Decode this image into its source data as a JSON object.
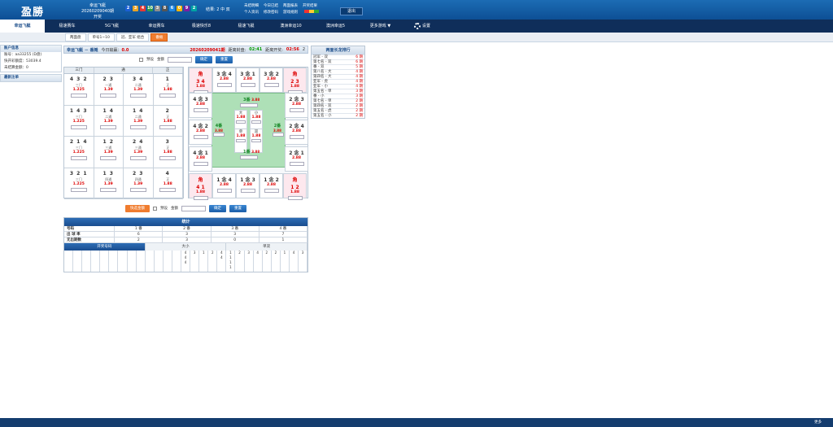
{
  "header": {
    "logo": "盈勝",
    "lottery_name": "幸运飞艇",
    "period_text": "20260209040期开奖",
    "balls": [
      {
        "num": "2",
        "color": "#1b5fd3"
      },
      {
        "num": "3",
        "color": "#e8a325"
      },
      {
        "num": "4",
        "color": "#e53935"
      },
      {
        "num": "10",
        "color": "#2e9a46"
      },
      {
        "num": "3",
        "color": "#8d8d8d"
      },
      {
        "num": "8",
        "color": "#555555"
      },
      {
        "num": "6",
        "color": "#1e88e5"
      },
      {
        "num": "0",
        "color": "#f6b400"
      },
      {
        "num": "9",
        "color": "#7b1fa2"
      },
      {
        "num": "2",
        "color": "#00a3a3"
      }
    ],
    "result_label": "结果:",
    "result_a": "2",
    "result_b": "中 双",
    "links": [
      "未结明细",
      "今日已结",
      "两面报表",
      "开奖结果",
      "个人资讯",
      "修改密码",
      "游戏规则",
      ""
    ],
    "logout": "退出"
  },
  "nav": {
    "tabs": [
      "幸运飞艇",
      "极速赛车",
      "5G飞艇",
      "幸运赛车",
      "极速快乐8",
      "极速飞艇",
      "澳洲幸运10",
      "澳洲幸运5",
      "更多游戏 ▼"
    ],
    "settings": "设置"
  },
  "subnav": [
    "两面盘",
    "单号1~10",
    "冠、亚军 组合",
    "番摊"
  ],
  "side": {
    "account_title": "账户信息",
    "account_label": "账号：",
    "account_value": "aa33255 (D盘)",
    "credit_label": "快开彩额度：",
    "credit_value": "53039.4",
    "unsettled_label": "未结算金额：",
    "unsettled_value": "0",
    "recent_title": "最新注单"
  },
  "main": {
    "game": "幸运飞艇 － 番摊",
    "pnl_label": "今日输赢：",
    "pnl_value": "0.0",
    "period": "20260209041期",
    "close_label": "距离封盘:",
    "close_time": "02:41",
    "draw_label": "距离开奖:",
    "draw_time": "02:56",
    "tail": "2",
    "preset": "预设",
    "amount": "金额",
    "confirm": "确定",
    "reset": "重置",
    "quick": "快选金额"
  },
  "table_heads": [
    "三门",
    "通",
    "正"
  ],
  "rows": [
    [
      {
        "n": "4 3 2",
        "l": "三门",
        "o": "1.225"
      },
      {
        "n": "2 3",
        "l": "一通",
        "o": "1.39"
      },
      {
        "n": "3 4",
        "l": "二通",
        "o": "1.39"
      },
      {
        "n": "1",
        "l": "正",
        "o": "1.88"
      }
    ],
    [
      {
        "n": "1 4 3",
        "l": "三门",
        "o": "1.225"
      },
      {
        "n": "1 4",
        "l": "二通",
        "o": "1.39"
      },
      {
        "n": "1 4",
        "l": "二通",
        "o": "1.39"
      },
      {
        "n": "2",
        "l": "正",
        "o": "1.88"
      }
    ],
    [
      {
        "n": "2 1 4",
        "l": "三门",
        "o": "1.225"
      },
      {
        "n": "1 2",
        "l": "三通",
        "o": "1.39"
      },
      {
        "n": "2 4",
        "l": "三通",
        "o": "1.39"
      },
      {
        "n": "3",
        "l": "正",
        "o": "1.88"
      }
    ],
    [
      {
        "n": "3 2 1",
        "l": "三门",
        "o": "1.225"
      },
      {
        "n": "1 3",
        "l": "四通",
        "o": "1.39"
      },
      {
        "n": "2 3",
        "l": "四通",
        "o": "1.39"
      },
      {
        "n": "4",
        "l": "正",
        "o": "1.88"
      }
    ]
  ],
  "board": {
    "top": [
      {
        "n": "角",
        "s": "3 4",
        "o": "1.88",
        "p": true
      },
      {
        "n": "3 念 4",
        "o": "2.88"
      },
      {
        "n": "3 念 1",
        "o": "2.88"
      },
      {
        "n": "3 念 2",
        "o": "2.88"
      },
      {
        "n": "角",
        "s": "2 3",
        "o": "1.88",
        "p": true
      }
    ],
    "left": [
      {
        "n": "4 念 3",
        "o": "2.88"
      },
      {
        "n": "4 念 2",
        "o": "2.88"
      },
      {
        "n": "4 念 1",
        "o": "2.88"
      }
    ],
    "right": [
      {
        "n": "2 念 3",
        "o": "2.88"
      },
      {
        "n": "2 念 4",
        "o": "2.88"
      },
      {
        "n": "2 念 1",
        "o": "2.88"
      }
    ],
    "bottom": [
      {
        "n": "角",
        "s": "4 1",
        "o": "1.88",
        "p": true
      },
      {
        "n": "1 念 4",
        "o": "2.88"
      },
      {
        "n": "1 念 3",
        "o": "2.88"
      },
      {
        "n": "1 念 2",
        "o": "2.88"
      },
      {
        "n": "角",
        "s": "1 2",
        "o": "1.88",
        "p": true
      }
    ],
    "fan3": "3番",
    "fan3_o": "3.88",
    "fan4": "4番",
    "fan4_o": "3.88",
    "fan2": "2番",
    "fan2_o": "3.88",
    "fan1": "1番",
    "fan1_o": "3.88",
    "big": "大",
    "big_o": "1.88",
    "small": "小",
    "small_o": "1.88",
    "odd": "单",
    "odd_o": "1.88",
    "even": "双",
    "even_o": "1.88"
  },
  "stats": {
    "title": "统计",
    "cols": [
      "号码",
      "1 番",
      "2 番",
      "3 番",
      "4 番"
    ],
    "row1": [
      "出 球 率",
      "6",
      "3",
      "3",
      "7"
    ],
    "row2": [
      "无出期数",
      "2",
      "3",
      "0",
      "1"
    ],
    "tabs": [
      "开奖号码",
      "大小",
      "单双"
    ],
    "road": [
      "",
      "",
      "",
      "",
      "",
      "",
      "",
      "",
      "",
      "",
      "",
      "",
      "",
      "4\n4\n4",
      "3",
      "1",
      "2",
      "4\n4",
      "1\n1\n1\n1",
      "2",
      "3",
      "4",
      "2",
      "2",
      "1",
      "4",
      "3"
    ]
  },
  "rank": {
    "title": "两面长龙排行",
    "items": [
      {
        "a": "冠军 - 双",
        "b": "6 期"
      },
      {
        "a": "第七名 - 双",
        "b": "6 期"
      },
      {
        "a": "番 - 双",
        "b": "5 期"
      },
      {
        "a": "第八名 - 大",
        "b": "4 期"
      },
      {
        "a": "第四名 - 大",
        "b": "4 期"
      },
      {
        "a": "亚军 - 虎",
        "b": "4 期"
      },
      {
        "a": "亚军 - 小",
        "b": "4 期"
      },
      {
        "a": "第五名 - 单",
        "b": "3 期"
      },
      {
        "a": "番 - 小",
        "b": "3 期"
      },
      {
        "a": "第七名 - 单",
        "b": "2 期"
      },
      {
        "a": "第四名 - 双",
        "b": "2 期"
      },
      {
        "a": "第五名 - 虎",
        "b": "2 期"
      },
      {
        "a": "第五名 - 小",
        "b": "2 期"
      }
    ]
  },
  "footer": "更多"
}
